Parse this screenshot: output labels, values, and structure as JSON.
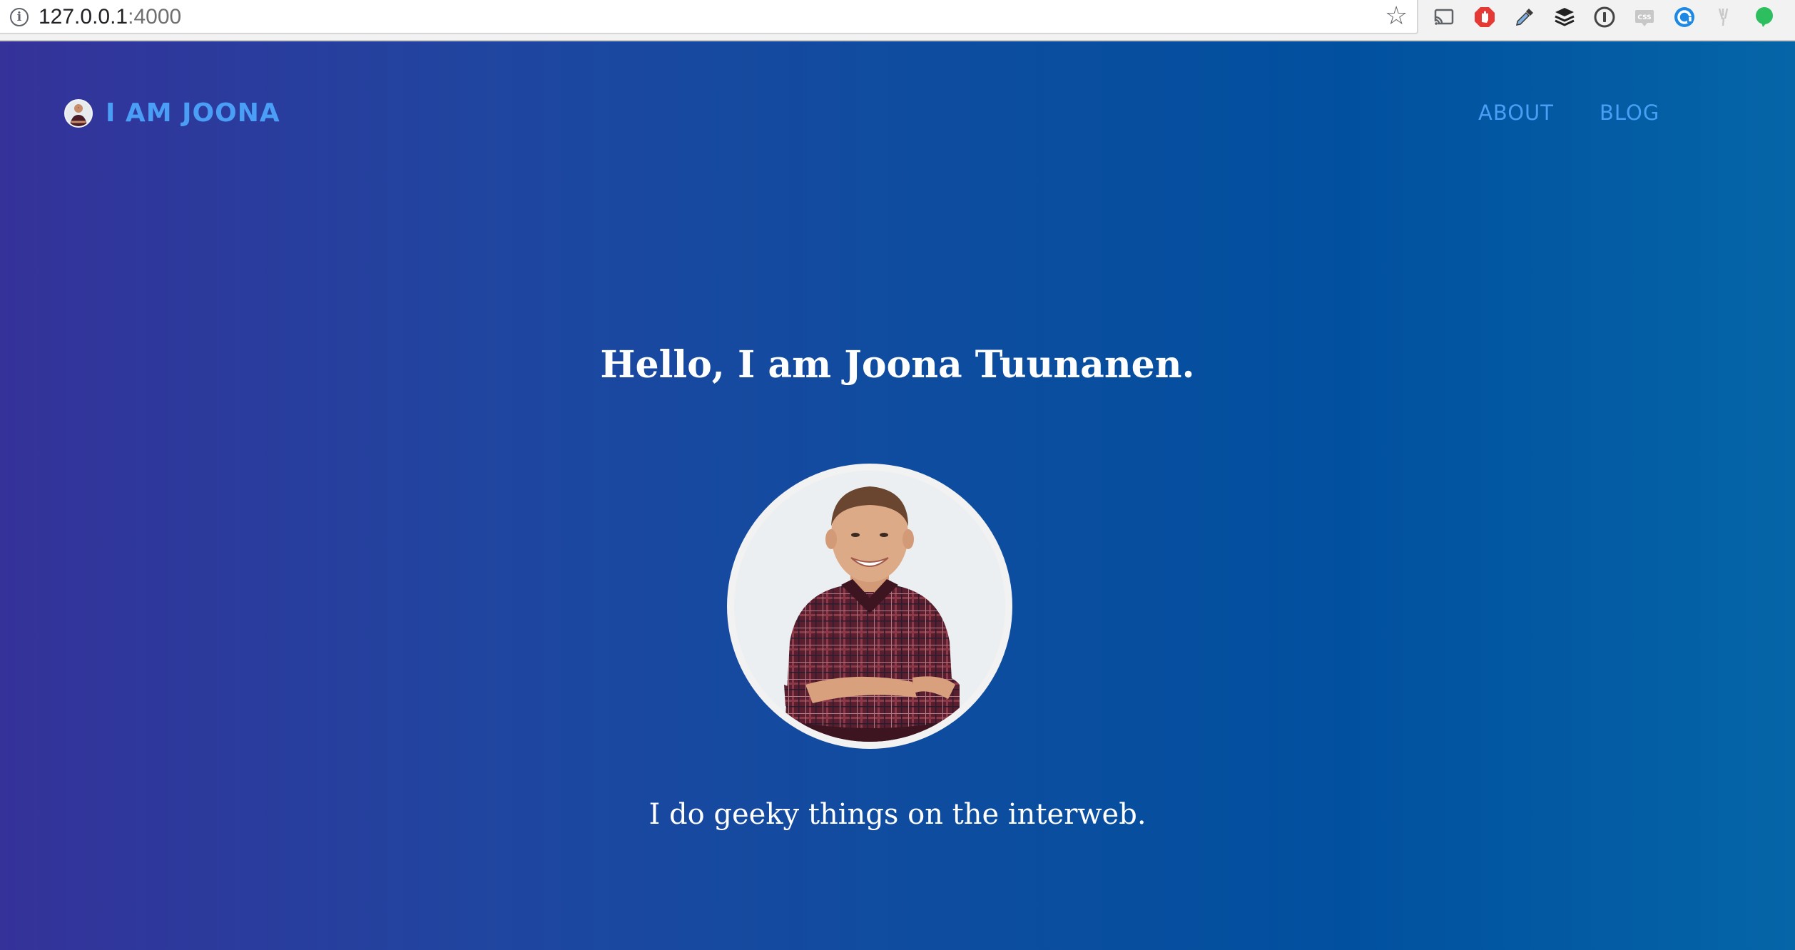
{
  "browser": {
    "url_host": "127.0.0.1",
    "url_port": ":4000",
    "icons": [
      "info-icon",
      "bookmark-star-icon",
      "cast-icon",
      "adblock-icon",
      "eyedropper-icon",
      "buffer-icon",
      "onepassword-icon",
      "css-viewer-icon",
      "extension-at-icon",
      "wappalyzer-icon",
      "evernote-icon"
    ]
  },
  "header": {
    "brand_text": "I AM JOONA",
    "nav": [
      {
        "label": "ABOUT"
      },
      {
        "label": "BLOG"
      }
    ]
  },
  "hero": {
    "title": "Hello, I am Joona Tuunanen.",
    "tagline": "I do geeky things on the interweb."
  },
  "colors": {
    "gradient_left": "#35329a",
    "gradient_mid": "#0f4c9f",
    "gradient_right": "#0565a7",
    "link": "#4a9ef5",
    "text": "#ffffff"
  }
}
